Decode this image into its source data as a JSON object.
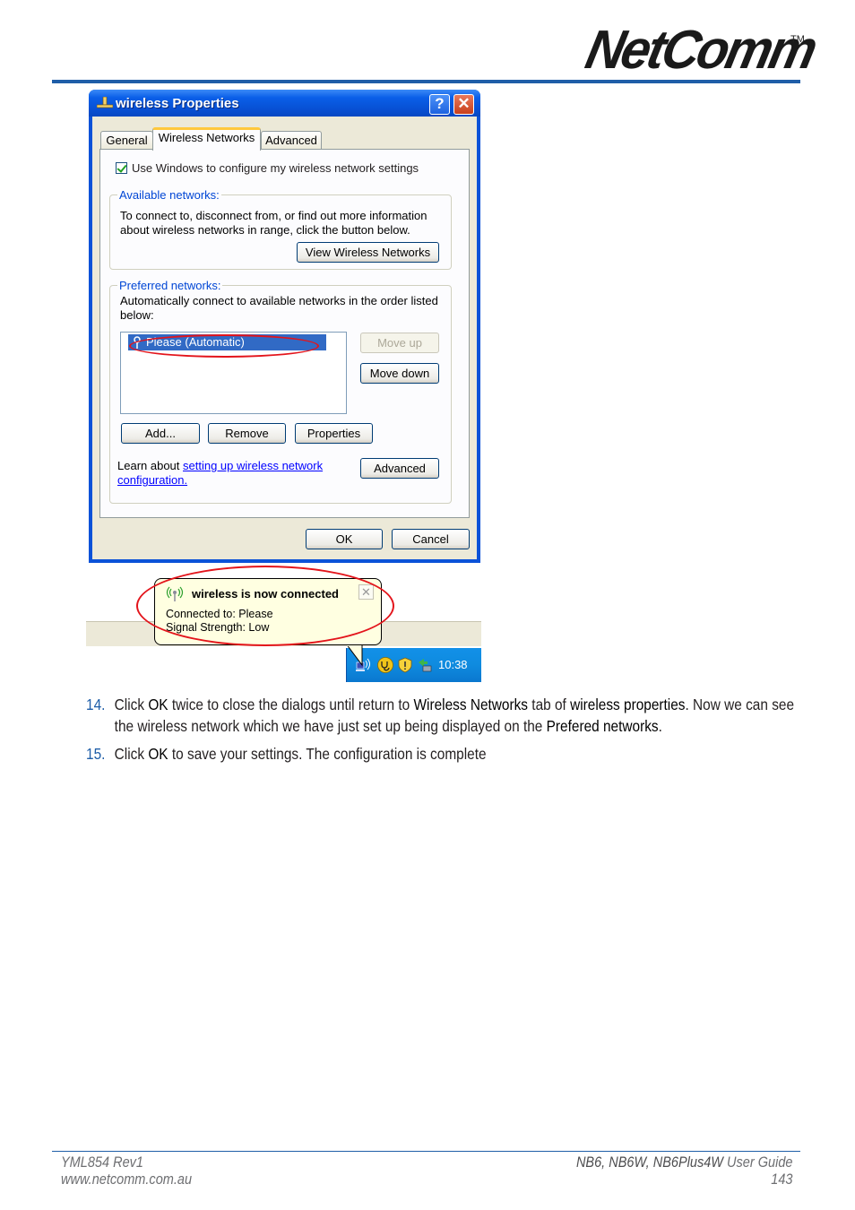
{
  "header": {
    "brand": "NetComm",
    "trademark": "TM",
    "accent_color": "#1f5ea8"
  },
  "dialog": {
    "title": "wireless Properties",
    "title_icon": "network-connection-icon",
    "help_button": "?",
    "close_button": "✕",
    "tabs": [
      {
        "label": "General",
        "active": false
      },
      {
        "label": "Wireless Networks",
        "active": true
      },
      {
        "label": "Advanced",
        "active": false
      }
    ],
    "use_windows_checkbox": {
      "label": "Use Windows to configure my wireless network settings",
      "checked": true
    },
    "available_networks": {
      "legend": "Available networks:",
      "description_line1": "To connect to, disconnect from, or find out more information",
      "description_line2": "about wireless networks in range, click the button below.",
      "view_button": "View Wireless Networks"
    },
    "preferred_networks": {
      "legend": "Preferred networks:",
      "description_line1": "Automatically connect to available networks in the order listed",
      "description_line2": "below:",
      "items": [
        {
          "label": "Please (Automatic)",
          "selected": true,
          "icon": "wireless-antenna-icon"
        }
      ],
      "move_up_button": "Move up",
      "move_down_button": "Move down",
      "add_button": "Add...",
      "remove_button": "Remove",
      "properties_button": "Properties",
      "learn_prefix": "Learn about ",
      "learn_link_line1": "setting up wireless network",
      "learn_link_line2": "configuration.",
      "advanced_button": "Advanced"
    },
    "ok_button": "OK",
    "cancel_button": "Cancel"
  },
  "notification": {
    "title": "wireless is now connected",
    "connected_to": "Connected to: Please",
    "signal_strength": "Signal Strength: Low",
    "close": "✕"
  },
  "taskbar": {
    "clock": "10:38",
    "tray_icons": [
      "wireless-network-icon",
      "stethoscope-icon",
      "security-shield-icon",
      "network-sync-icon"
    ]
  },
  "steps": [
    {
      "number": "14.",
      "parts": [
        {
          "text": "Click ",
          "bold": false
        },
        {
          "text": "OK",
          "bold": true
        },
        {
          "text": " twice to close the dialogs until return to ",
          "bold": false
        },
        {
          "text": "Wireless Networks",
          "bold": true
        },
        {
          "text": " tab of ",
          "bold": false
        },
        {
          "text": "wireless properties",
          "bold": true
        },
        {
          "text": ". Now we can see the wireless network which we have just set up being displayed on the ",
          "bold": false
        },
        {
          "text": "Prefered networks",
          "bold": true
        },
        {
          "text": ".",
          "bold": false
        }
      ]
    },
    {
      "number": "15.",
      "parts": [
        {
          "text": "Click ",
          "bold": false
        },
        {
          "text": "OK",
          "bold": true
        },
        {
          "text": " to save your settings. The configuration is complete",
          "bold": false
        }
      ]
    }
  ],
  "footer": {
    "doc_code": "YML854 Rev1",
    "website": "www.netcomm.com.au",
    "product": "NB6, NB6W, NB6Plus4W",
    "guide": " User Guide",
    "page_number": "143"
  }
}
